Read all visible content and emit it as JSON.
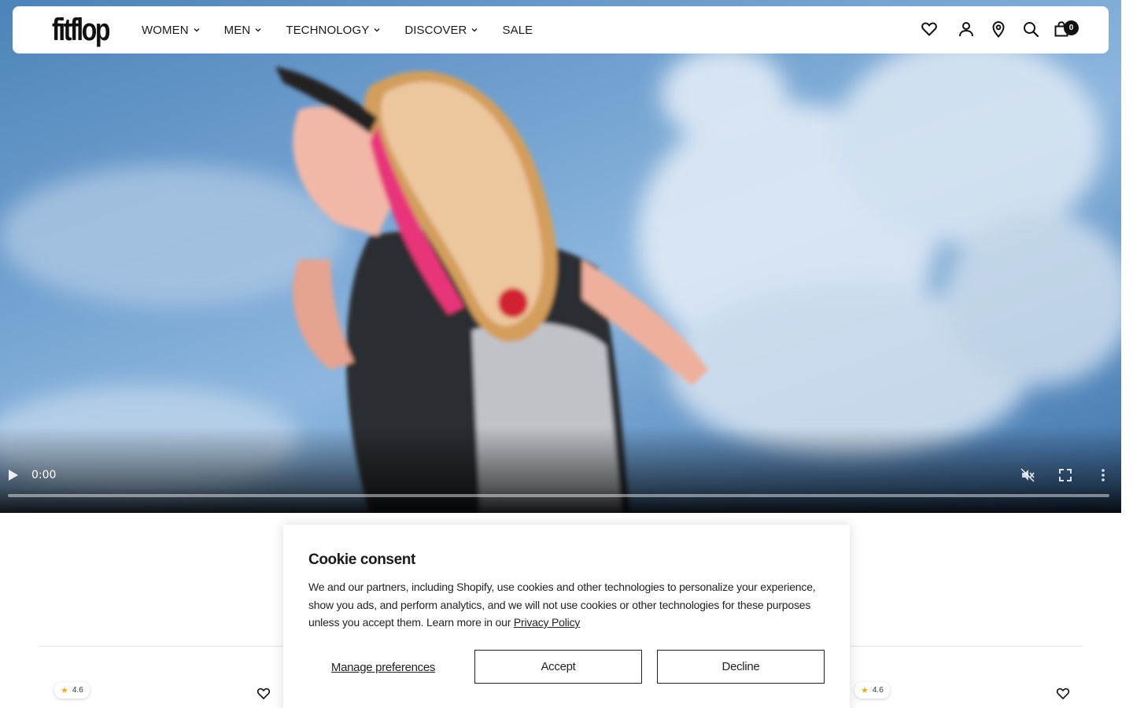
{
  "header": {
    "logo": "fitflop",
    "nav": [
      {
        "label": "WOMEN",
        "dropdown": true
      },
      {
        "label": "MEN",
        "dropdown": true
      },
      {
        "label": "TECHNOLOGY",
        "dropdown": true
      },
      {
        "label": "DISCOVER",
        "dropdown": true
      },
      {
        "label": "SALE",
        "dropdown": false
      }
    ],
    "icons": [
      "wishlist-icon",
      "account-icon",
      "store-locator-icon",
      "search-icon",
      "cart-icon"
    ],
    "cart_count": "0"
  },
  "video": {
    "current_time": "0:00",
    "progress": 0,
    "muted": true
  },
  "products": [
    {
      "rating": "4.6"
    },
    {
      "rating": "4.6"
    }
  ],
  "cookie": {
    "title": "Cookie consent",
    "text": "We and our partners, including Shopify, use cookies and other technologies to personalize your experience, show you ads, and perform analytics, and we will not use cookies or other technologies for these purposes unless you accept them. Learn more in our ",
    "link": "Privacy Policy",
    "manage": "Manage preferences",
    "accept": "Accept",
    "decline": "Decline"
  },
  "colors": {
    "text": "#1a1a1a",
    "star": "#f2a81d",
    "sky": "#6f9fce"
  }
}
